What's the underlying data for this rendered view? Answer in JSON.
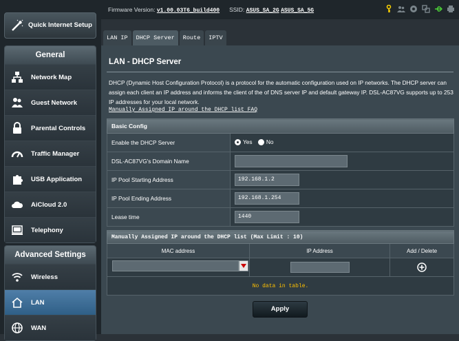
{
  "sidebar": {
    "quick_setup": "Quick Internet Setup",
    "general_title": "General",
    "general_items": [
      {
        "label": "Network Map",
        "icon": "network-map-icon"
      },
      {
        "label": "Guest Network",
        "icon": "guest-network-icon"
      },
      {
        "label": "Parental Controls",
        "icon": "lock-icon"
      },
      {
        "label": "Traffic Manager",
        "icon": "gauge-icon"
      },
      {
        "label": "USB Application",
        "icon": "puzzle-icon"
      },
      {
        "label": "AiCloud 2.0",
        "icon": "cloud-icon"
      },
      {
        "label": "Telephony",
        "icon": "phone-icon"
      }
    ],
    "advanced_title": "Advanced Settings",
    "advanced_items": [
      {
        "label": "Wireless",
        "icon": "wifi-icon"
      },
      {
        "label": "LAN",
        "icon": "house-icon",
        "active": true
      },
      {
        "label": "WAN",
        "icon": "globe-icon"
      }
    ]
  },
  "topbar": {
    "firmware_label": "Firmware Version:",
    "firmware_value": "v1.00.03T6_build400",
    "ssid_label": "SSID:",
    "ssid_2g": "ASUS_SA_2G",
    "ssid_5g": "ASUS_SA_5G"
  },
  "tabs": [
    "LAN IP",
    "DHCP Server",
    "Route",
    "IPTV"
  ],
  "active_tab": "DHCP Server",
  "page": {
    "title": "LAN - DHCP Server",
    "description": "DHCP (Dynamic Host Configuration Protocol) is a protocol for the automatic configuration used on IP networks. The DHCP server can assign each client an IP address and informs the client of the of DNS server IP and default gateway IP. DSL-AC87VG supports up to 253 IP addresses for your local network.",
    "faq_link": "Manually Assigned IP around the DHCP list FAQ"
  },
  "basic_config": {
    "section_title": "Basic Config",
    "enable_label": "Enable the DHCP Server",
    "yes_label": "Yes",
    "no_label": "No",
    "domain_label": "DSL-AC87VG's Domain Name",
    "domain_value": "",
    "start_label": "IP Pool Starting Address",
    "start_value": "192.168.1.2",
    "end_label": "IP Pool Ending Address",
    "end_value": "192.168.1.254",
    "lease_label": "Lease time",
    "lease_value": "1440"
  },
  "manual_list": {
    "section_title": "Manually Assigned IP around the DHCP list (Max Limit : 10)",
    "col_mac": "MAC address",
    "col_ip": "IP Address",
    "col_action": "Add / Delete",
    "empty_text": "No data in table."
  },
  "apply_label": "Apply",
  "colors": {
    "accent_active": "#4f7ea8",
    "warning_text": "#ffc000"
  }
}
